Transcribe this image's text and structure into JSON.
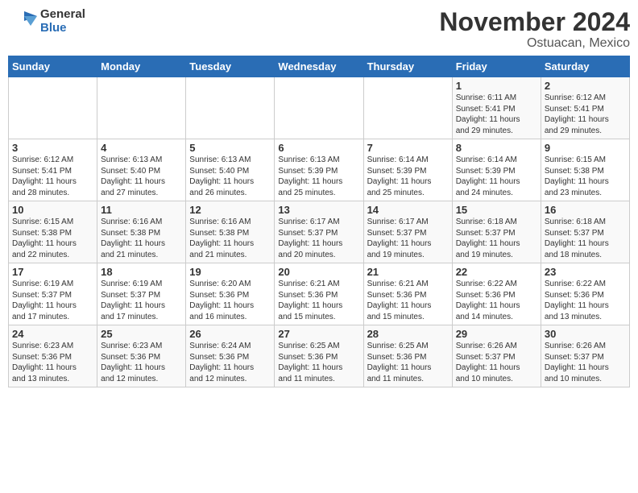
{
  "header": {
    "logo_general": "General",
    "logo_blue": "Blue",
    "month": "November 2024",
    "location": "Ostuacan, Mexico"
  },
  "weekdays": [
    "Sunday",
    "Monday",
    "Tuesday",
    "Wednesday",
    "Thursday",
    "Friday",
    "Saturday"
  ],
  "weeks": [
    [
      {
        "day": "",
        "info": ""
      },
      {
        "day": "",
        "info": ""
      },
      {
        "day": "",
        "info": ""
      },
      {
        "day": "",
        "info": ""
      },
      {
        "day": "",
        "info": ""
      },
      {
        "day": "1",
        "info": "Sunrise: 6:11 AM\nSunset: 5:41 PM\nDaylight: 11 hours\nand 29 minutes."
      },
      {
        "day": "2",
        "info": "Sunrise: 6:12 AM\nSunset: 5:41 PM\nDaylight: 11 hours\nand 29 minutes."
      }
    ],
    [
      {
        "day": "3",
        "info": "Sunrise: 6:12 AM\nSunset: 5:41 PM\nDaylight: 11 hours\nand 28 minutes."
      },
      {
        "day": "4",
        "info": "Sunrise: 6:13 AM\nSunset: 5:40 PM\nDaylight: 11 hours\nand 27 minutes."
      },
      {
        "day": "5",
        "info": "Sunrise: 6:13 AM\nSunset: 5:40 PM\nDaylight: 11 hours\nand 26 minutes."
      },
      {
        "day": "6",
        "info": "Sunrise: 6:13 AM\nSunset: 5:39 PM\nDaylight: 11 hours\nand 25 minutes."
      },
      {
        "day": "7",
        "info": "Sunrise: 6:14 AM\nSunset: 5:39 PM\nDaylight: 11 hours\nand 25 minutes."
      },
      {
        "day": "8",
        "info": "Sunrise: 6:14 AM\nSunset: 5:39 PM\nDaylight: 11 hours\nand 24 minutes."
      },
      {
        "day": "9",
        "info": "Sunrise: 6:15 AM\nSunset: 5:38 PM\nDaylight: 11 hours\nand 23 minutes."
      }
    ],
    [
      {
        "day": "10",
        "info": "Sunrise: 6:15 AM\nSunset: 5:38 PM\nDaylight: 11 hours\nand 22 minutes."
      },
      {
        "day": "11",
        "info": "Sunrise: 6:16 AM\nSunset: 5:38 PM\nDaylight: 11 hours\nand 21 minutes."
      },
      {
        "day": "12",
        "info": "Sunrise: 6:16 AM\nSunset: 5:38 PM\nDaylight: 11 hours\nand 21 minutes."
      },
      {
        "day": "13",
        "info": "Sunrise: 6:17 AM\nSunset: 5:37 PM\nDaylight: 11 hours\nand 20 minutes."
      },
      {
        "day": "14",
        "info": "Sunrise: 6:17 AM\nSunset: 5:37 PM\nDaylight: 11 hours\nand 19 minutes."
      },
      {
        "day": "15",
        "info": "Sunrise: 6:18 AM\nSunset: 5:37 PM\nDaylight: 11 hours\nand 19 minutes."
      },
      {
        "day": "16",
        "info": "Sunrise: 6:18 AM\nSunset: 5:37 PM\nDaylight: 11 hours\nand 18 minutes."
      }
    ],
    [
      {
        "day": "17",
        "info": "Sunrise: 6:19 AM\nSunset: 5:37 PM\nDaylight: 11 hours\nand 17 minutes."
      },
      {
        "day": "18",
        "info": "Sunrise: 6:19 AM\nSunset: 5:37 PM\nDaylight: 11 hours\nand 17 minutes."
      },
      {
        "day": "19",
        "info": "Sunrise: 6:20 AM\nSunset: 5:36 PM\nDaylight: 11 hours\nand 16 minutes."
      },
      {
        "day": "20",
        "info": "Sunrise: 6:21 AM\nSunset: 5:36 PM\nDaylight: 11 hours\nand 15 minutes."
      },
      {
        "day": "21",
        "info": "Sunrise: 6:21 AM\nSunset: 5:36 PM\nDaylight: 11 hours\nand 15 minutes."
      },
      {
        "day": "22",
        "info": "Sunrise: 6:22 AM\nSunset: 5:36 PM\nDaylight: 11 hours\nand 14 minutes."
      },
      {
        "day": "23",
        "info": "Sunrise: 6:22 AM\nSunset: 5:36 PM\nDaylight: 11 hours\nand 13 minutes."
      }
    ],
    [
      {
        "day": "24",
        "info": "Sunrise: 6:23 AM\nSunset: 5:36 PM\nDaylight: 11 hours\nand 13 minutes."
      },
      {
        "day": "25",
        "info": "Sunrise: 6:23 AM\nSunset: 5:36 PM\nDaylight: 11 hours\nand 12 minutes."
      },
      {
        "day": "26",
        "info": "Sunrise: 6:24 AM\nSunset: 5:36 PM\nDaylight: 11 hours\nand 12 minutes."
      },
      {
        "day": "27",
        "info": "Sunrise: 6:25 AM\nSunset: 5:36 PM\nDaylight: 11 hours\nand 11 minutes."
      },
      {
        "day": "28",
        "info": "Sunrise: 6:25 AM\nSunset: 5:36 PM\nDaylight: 11 hours\nand 11 minutes."
      },
      {
        "day": "29",
        "info": "Sunrise: 6:26 AM\nSunset: 5:37 PM\nDaylight: 11 hours\nand 10 minutes."
      },
      {
        "day": "30",
        "info": "Sunrise: 6:26 AM\nSunset: 5:37 PM\nDaylight: 11 hours\nand 10 minutes."
      }
    ]
  ]
}
